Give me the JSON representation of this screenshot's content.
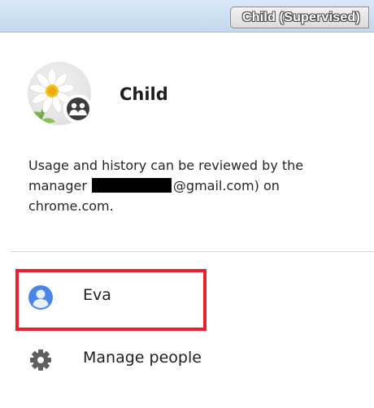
{
  "window": {
    "profile_badge": "Child (Supervised)"
  },
  "profile": {
    "name": "Child",
    "avatar_icon": "daisy-flower-avatar",
    "badge_icon": "supervised-user-icon",
    "description_before": "Usage and history can be reviewed by the manager",
    "description_after": "@gmail.com) on chrome.com."
  },
  "menu": {
    "items": [
      {
        "label": "Eva",
        "icon": "person-icon",
        "icon_color": "#4a86e8"
      },
      {
        "label": "Manage people",
        "icon": "gear-icon",
        "icon_color": "#5f5f5f"
      }
    ]
  },
  "annotation": {
    "highlight_color": "#e8212e"
  }
}
